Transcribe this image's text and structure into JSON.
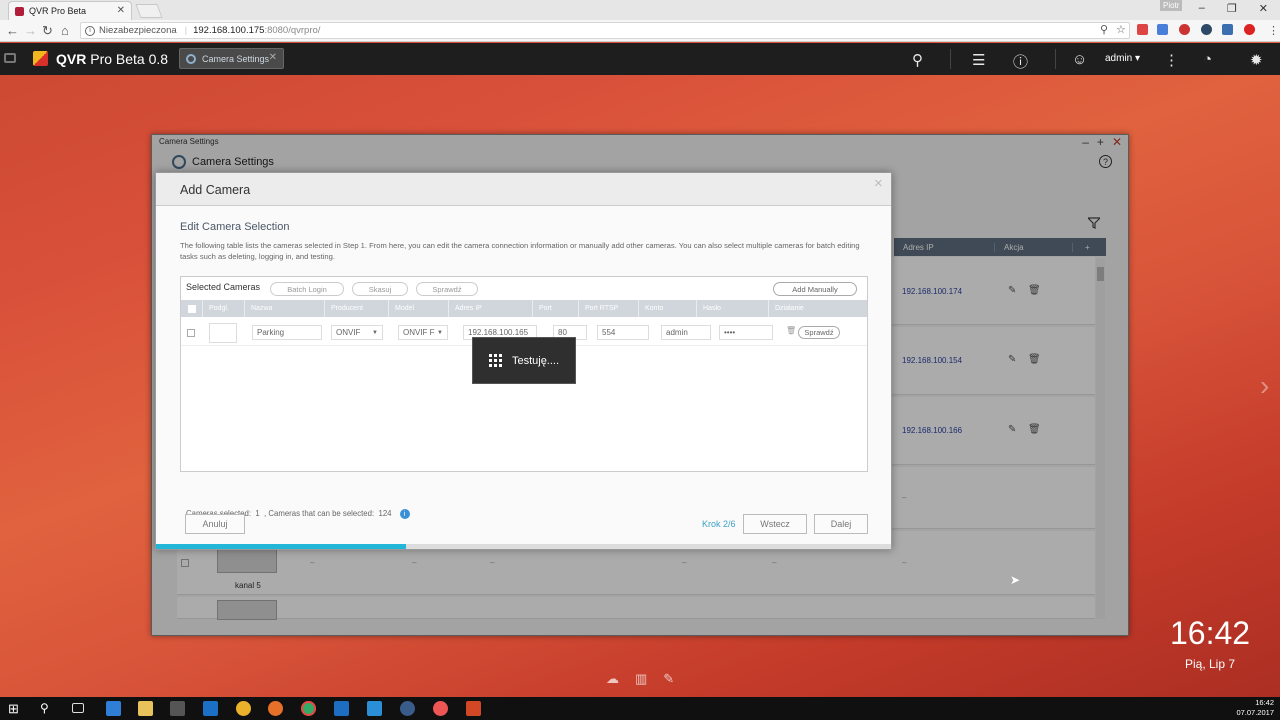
{
  "browser": {
    "tab_title": "QVR Pro Beta",
    "tab_close": "✕",
    "window_tag": "Piotr",
    "security_label": "Niezabezpieczona",
    "url_host": "192.168.100.175",
    "url_path": ":8080/qvrpro/"
  },
  "app": {
    "title_bold": "QVR",
    "title_rest": " Pro Beta 0.8",
    "open_tab": "Camera Settings",
    "user": "admin ▾"
  },
  "camera_settings": {
    "window_title": "Camera Settings",
    "header": "Camera Settings",
    "table_headers": [
      "Adres IP",
      "Akcja",
      "+"
    ],
    "rows": [
      {
        "ip": "192.168.100.174"
      },
      {
        "ip": "192.168.100.154"
      },
      {
        "ip": "192.168.100.166"
      }
    ],
    "row5_label": "kanal 5",
    "dash": "–"
  },
  "dialog": {
    "title": "Add Camera",
    "subtitle": "Edit Camera Selection",
    "description": "The following table lists the cameras selected in Step 1. From here, you can edit the camera connection information or manually add other cameras. You can also select multiple cameras for batch editing tasks such as deleting, logging in, and testing.",
    "selected_title": "Selected Cameras",
    "btn_batch_login": "Batch Login",
    "btn_delete": "Skasuj",
    "btn_check": "Sprawdź",
    "btn_add_manually": "Add Manually",
    "columns": [
      "Podgl.",
      "Nazwa",
      "Producent",
      "Model",
      "Adres IP",
      "Port",
      "Port RTSP",
      "Konto",
      "Hasło",
      "Działanie"
    ],
    "camera": {
      "name": "Parking",
      "manufacturer": "ONVIF",
      "model": "ONVIF F",
      "ip": "192.168.100.165",
      "port": "80",
      "rtsp": "554",
      "account": "admin",
      "password": "••••",
      "action": "Sprawdź"
    },
    "counts_prefix": "Cameras selected:",
    "counts_selected": "1",
    "counts_mid": ", Cameras that can be selected:",
    "counts_available": "124",
    "btn_cancel": "Anuluj",
    "step": "Krok 2/6",
    "btn_back": "Wstecz",
    "btn_next": "Dalej",
    "progress": 0.34
  },
  "testing": {
    "label": "Testuję...."
  },
  "desktop": {
    "clock": "16:42",
    "date": "Pią, Lip 7"
  },
  "taskbar": {
    "time": "16:42",
    "date": "07.07.2017"
  },
  "colors": {
    "accent": "#22b7d9",
    "header_bg": "#1e1e1e",
    "table_header": "#5e6f80",
    "ip_link": "#2a3fa0"
  }
}
